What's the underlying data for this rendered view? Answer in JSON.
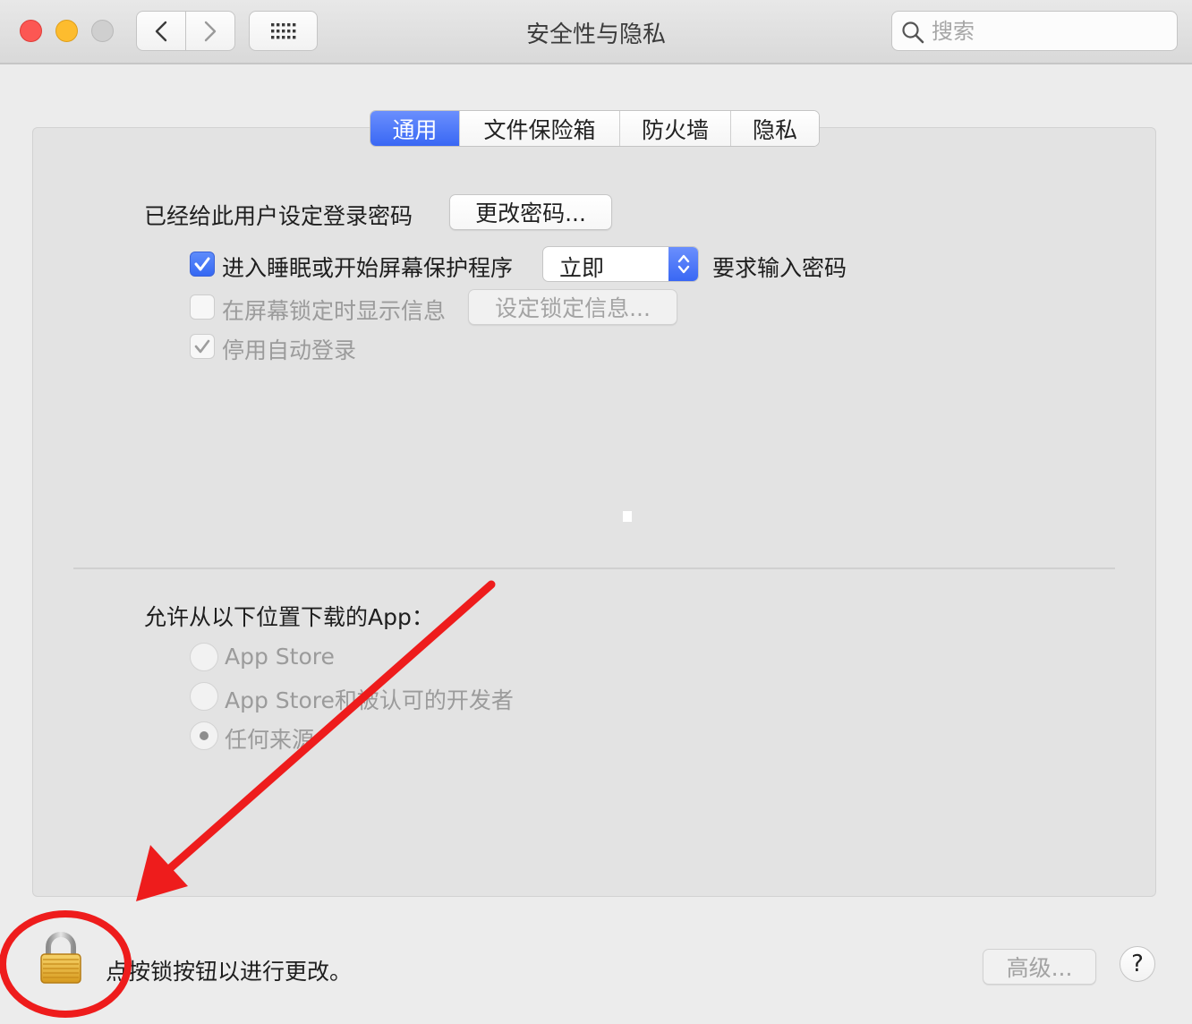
{
  "window": {
    "title": "安全性与隐私"
  },
  "search": {
    "placeholder": "搜索",
    "value": ""
  },
  "tabs": [
    {
      "label": "通用",
      "active": true
    },
    {
      "label": "文件保险箱",
      "active": false
    },
    {
      "label": "防火墙",
      "active": false
    },
    {
      "label": "隐私",
      "active": false
    }
  ],
  "general": {
    "password_set_label": "已经给此用户设定登录密码",
    "change_password_button": "更改密码...",
    "require_password": {
      "checked": true,
      "label": "进入睡眠或开始屏幕保护程序",
      "delay_value": "立即",
      "suffix": "要求输入密码"
    },
    "show_message": {
      "checked": false,
      "enabled": false,
      "label": "在屏幕锁定时显示信息",
      "button": "设定锁定信息..."
    },
    "disable_autologin": {
      "checked": true,
      "enabled": false,
      "label": "停用自动登录"
    }
  },
  "downloads": {
    "heading": "允许从以下位置下载的App：",
    "options": [
      {
        "label": "App Store",
        "selected": false
      },
      {
        "label": "App Store和被认可的开发者",
        "selected": false
      },
      {
        "label": "任何来源",
        "selected": true
      }
    ]
  },
  "footer": {
    "lock_message": "点按锁按钮以进行更改。",
    "advanced_button": "高级...",
    "help_button": "?"
  },
  "icons": {
    "back": "chevron-left-icon",
    "forward": "chevron-right-icon",
    "grid": "grid-icon",
    "search": "magnifier-icon",
    "lock": "lock-icon"
  },
  "colors": {
    "accent": "#3a6cf4",
    "annotation": "#ee1c1c",
    "close": "#fc5753",
    "minimize": "#fdbc2e"
  }
}
